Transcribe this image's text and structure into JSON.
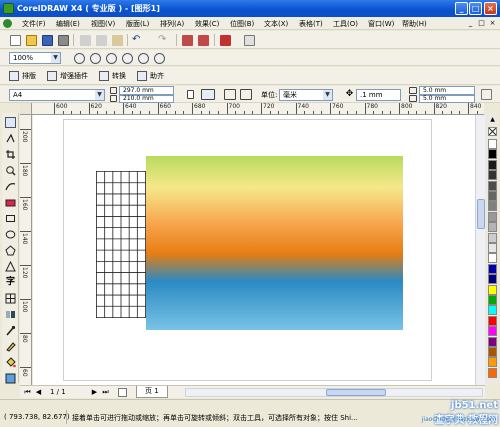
{
  "window": {
    "title": "CorelDRAW X4 ( 专业版 ) - [图形1]",
    "controls": [
      "_",
      "□",
      "×"
    ]
  },
  "menu": {
    "items": [
      "文件(F)",
      "编辑(E)",
      "视图(V)",
      "版面(L)",
      "排列(A)",
      "效果(C)",
      "位图(B)",
      "文本(X)",
      "表格(T)",
      "工具(O)",
      "窗口(W)",
      "帮助(H)"
    ],
    "doc_controls": [
      "_",
      "□",
      "×"
    ]
  },
  "toolbar": {
    "zoom": "100%"
  },
  "panel_buttons": {
    "items": [
      "排版",
      "增强插件",
      "转换",
      "助齐"
    ]
  },
  "property_bar": {
    "page_size": "A4",
    "width": "297.0 mm",
    "height": "210.0 mm",
    "unit_label": "单位:",
    "unit": "毫米",
    "nudge": ".1 mm",
    "dup_x": "5.0 mm",
    "dup_y": "5.0 mm"
  },
  "ruler": {
    "h_labels": [
      "600",
      "620",
      "640",
      "660",
      "680",
      "700",
      "720",
      "740",
      "760",
      "780",
      "800",
      "820",
      "840"
    ],
    "v_labels": [
      "200",
      "180",
      "160",
      "140",
      "120",
      "100",
      "80",
      "60"
    ]
  },
  "canvas": {
    "gradient_colors": [
      "#b7db5d",
      "#f5e88a",
      "#f7a24a",
      "#e77d12",
      "#2a8ac2",
      "#79c3e6"
    ],
    "grid_cols": 6,
    "grid_rows": 13
  },
  "palette": {
    "colors": [
      "#ffffff",
      "#000000",
      "#1a1a1a",
      "#333333",
      "#4d4d4d",
      "#666666",
      "#808080",
      "#999999",
      "#b3b3b3",
      "#cccccc",
      "#e6e6e6",
      "#ffffff",
      "#0000aa",
      "#00007f",
      "#ffff00",
      "#00aa00",
      "#00ffff",
      "#ff0000",
      "#ff00ff",
      "#7f007f",
      "#aa5500",
      "#ff9900",
      "#ff6600"
    ]
  },
  "pagebar": {
    "page_counter": "1 / 1",
    "page_tab": "页 1"
  },
  "status": {
    "coords": "( 793.738, 82.677)",
    "hint": "接着单击可进行拖动或缩放；再单击可旋转或倾斜；双击工具，可选择所有对象；按住 Shi...",
    "watermark": "查字典 教程网",
    "watermark_url": "jiaocheng.chazidian.com",
    "site": "jb51.net"
  }
}
